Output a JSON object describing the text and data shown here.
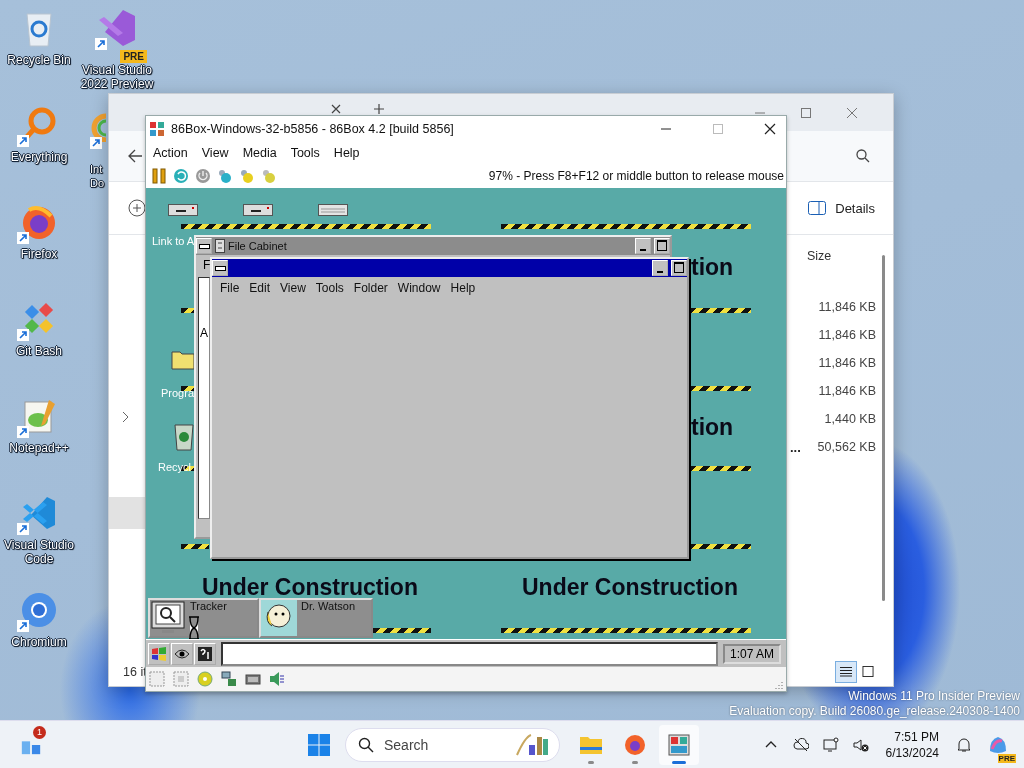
{
  "desktop": {
    "column_1": [
      {
        "label": "Recycle Bin",
        "kind": "recycle",
        "shortcut": false
      },
      {
        "label": "Everything",
        "kind": "everything",
        "shortcut": true
      },
      {
        "label": "Firefox",
        "kind": "firefox",
        "shortcut": true
      },
      {
        "label": "Git Bash",
        "kind": "gitbash",
        "shortcut": true
      },
      {
        "label": "Notepad++",
        "kind": "notepadpp",
        "shortcut": true
      },
      {
        "label": "Visual Studio Code",
        "kind": "vscode",
        "shortcut": true
      },
      {
        "label": "Chromium",
        "kind": "chromium",
        "shortcut": true
      }
    ],
    "column_2": [
      {
        "label": "Visual Studio 2022 Preview",
        "kind": "vs-pre",
        "shortcut": true,
        "badge": "PRE"
      },
      {
        "label": "Int Do",
        "kind": "partial",
        "shortcut": true
      }
    ]
  },
  "explorer": {
    "details_button": "Details",
    "column_header": "Size",
    "sizes": [
      "11,846 KB",
      "11,846 KB",
      "11,846 KB",
      "11,846 KB",
      "1,440 KB",
      "50,562 KB"
    ],
    "overflow_mark": "...",
    "status": "16 it",
    "view_buttons": [
      {
        "kind": "details",
        "selected": true
      },
      {
        "kind": "tiles",
        "selected": false
      }
    ]
  },
  "emulator": {
    "title": "86Box-Windows-32-b5856 - 86Box 4.2 [build 5856]",
    "menu": [
      "Action",
      "View",
      "Media",
      "Tools",
      "Help"
    ],
    "status_text": "97% - Press F8+F12 or middle button to release mouse",
    "guest": {
      "icons": [
        {
          "label": "Link to A",
          "kind": "link"
        },
        {
          "label": "Progra",
          "kind": "folder"
        },
        {
          "label": "Recycl",
          "kind": "recycle"
        }
      ],
      "banners": [
        "tion",
        "tion",
        "Under Construction",
        "Under Construction"
      ],
      "file_cabinet": {
        "title": "File Cabinet",
        "menu_fragment": "F",
        "pane_text": "A"
      },
      "inner_window": {
        "menu": [
          "File",
          "Edit",
          "View",
          "Tools",
          "Folder",
          "Window",
          "Help"
        ]
      },
      "tasks": [
        {
          "label": "Tracker",
          "kind": "tracker",
          "busy": true
        },
        {
          "label": "Dr. Watson",
          "kind": "drwatson",
          "busy": false
        }
      ],
      "clock": "1:07 AM"
    }
  },
  "taskbar": {
    "widget_badge": "1",
    "search": {
      "placeholder": "Search"
    },
    "apps": [
      {
        "kind": "explorer",
        "selected": false
      },
      {
        "kind": "firefox",
        "selected": false
      },
      {
        "kind": "emulator",
        "selected": true
      }
    ],
    "time": "7:51 PM",
    "date": "6/13/2024",
    "copilot_badge": "PRE"
  },
  "watermark": [
    "Windows 11 Pro Insider Preview",
    "Evaluation copy. Build 26080.ge_release.240308-1400"
  ]
}
